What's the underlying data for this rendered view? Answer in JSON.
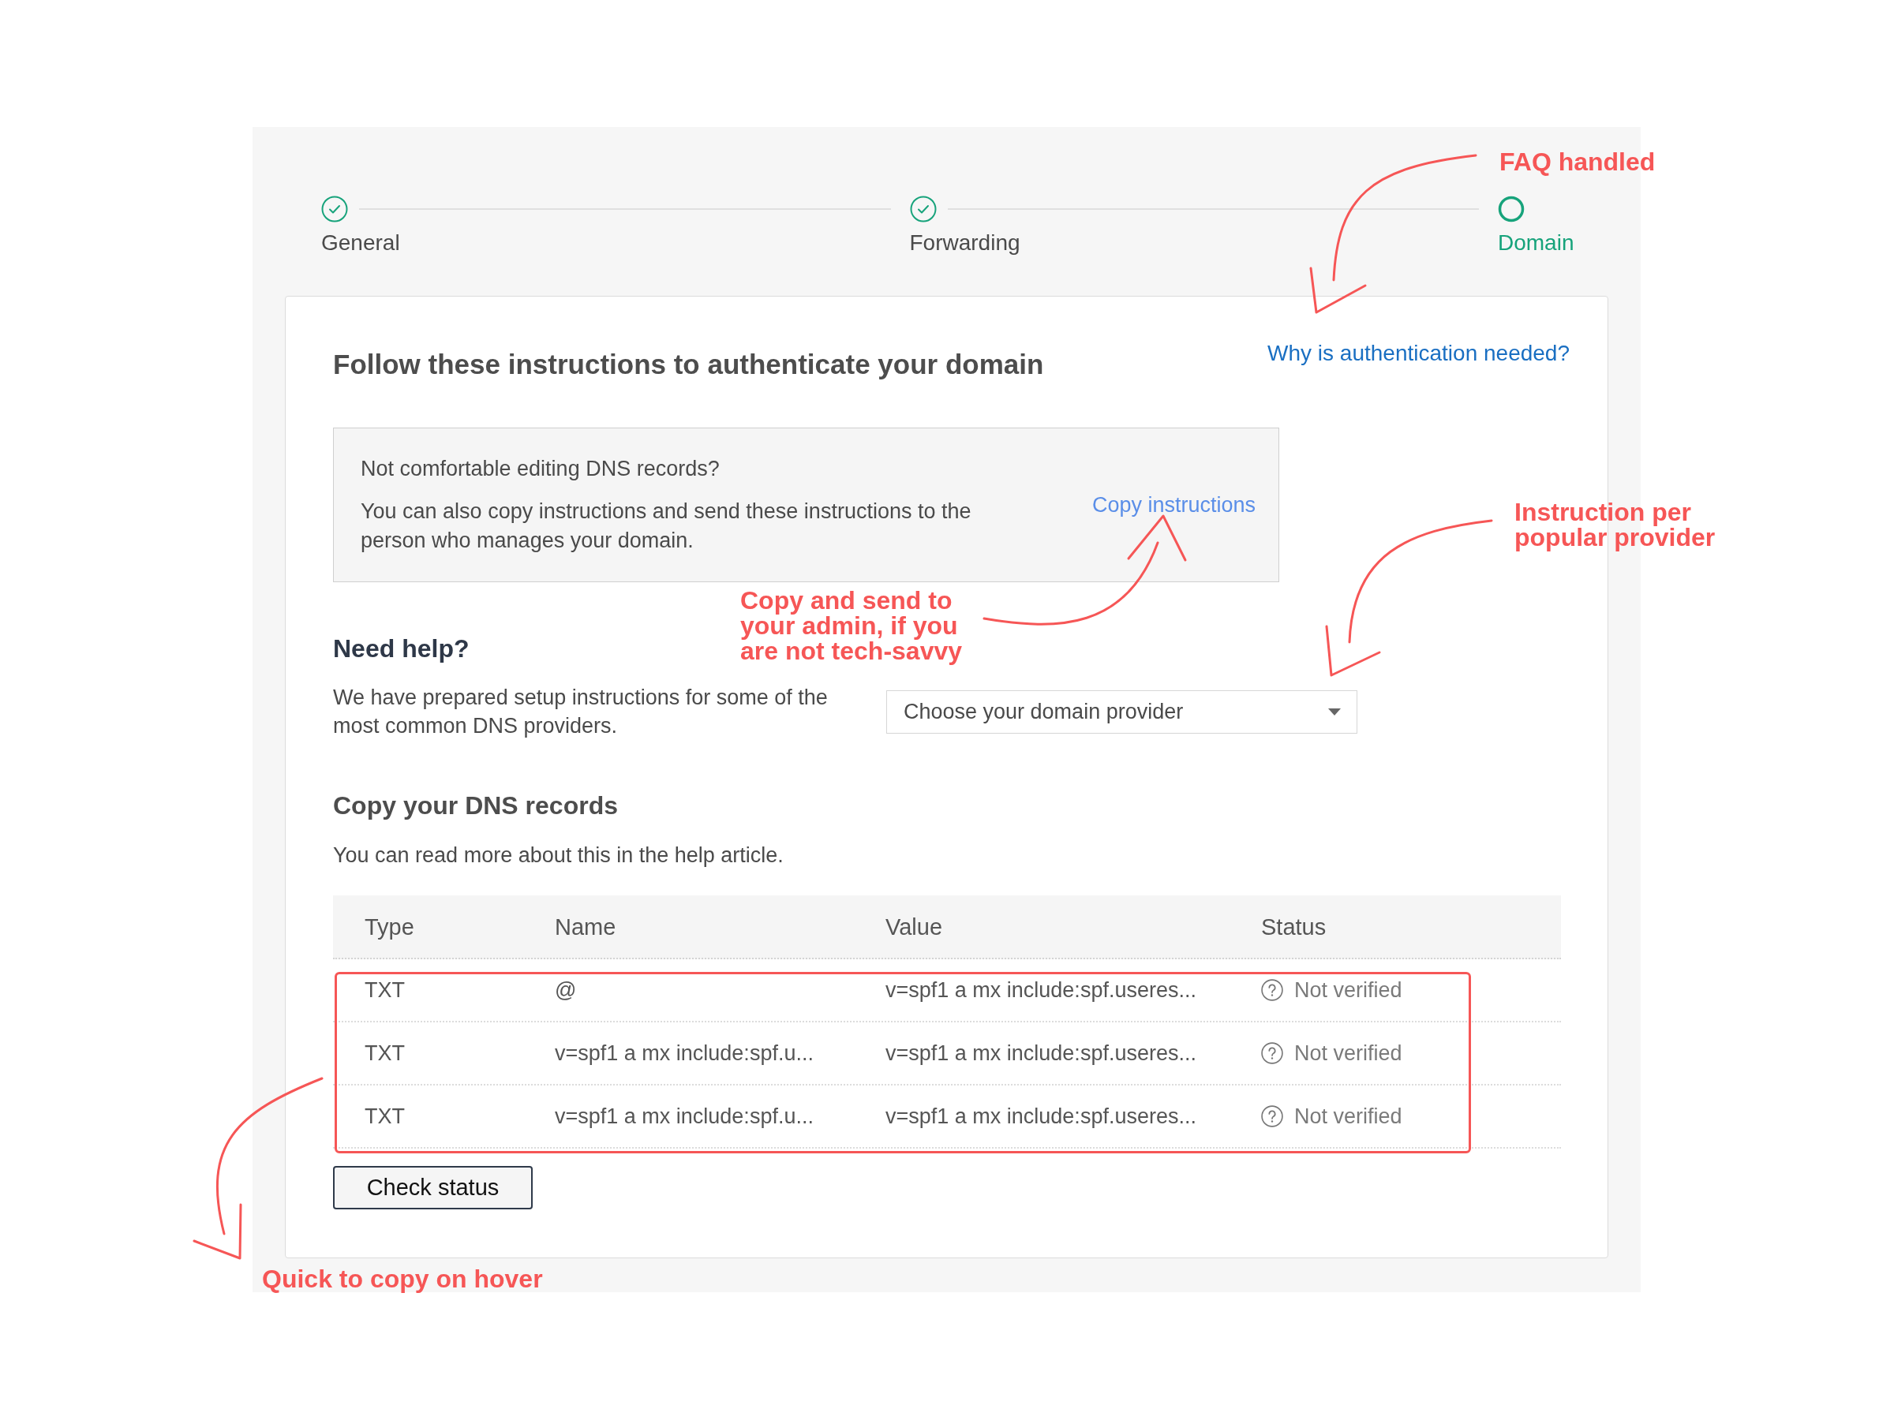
{
  "steps": [
    {
      "label": "General",
      "completed": true,
      "selected": false
    },
    {
      "label": "Forwarding",
      "completed": true,
      "selected": false
    },
    {
      "label": "Domain",
      "completed": false,
      "selected": true
    }
  ],
  "card": {
    "title": "Follow these instructions to authenticate your domain",
    "help_link": "Why is authentication needed?",
    "info_box": {
      "title": "Not comfortable editing DNS records?",
      "text": "You can also copy instructions and send these instructions to the person who manages your domain.",
      "link": "Copy instructions"
    },
    "help_section": {
      "title": "Need help?",
      "text": "We have prepared setup instructions for some of the most common DNS providers.",
      "dropdown": {
        "placeholder": "Choose your domain provider"
      }
    },
    "records_section": {
      "title": "Copy your DNS records",
      "text": "You can read more about this in the help article.",
      "table": {
        "columns": [
          "Type",
          "Name",
          "Value",
          "Status"
        ],
        "rows": [
          {
            "type": "TXT",
            "name": "@",
            "value": "v=spf1 a mx include:spf.useres...",
            "status": "Not verified"
          },
          {
            "type": "TXT",
            "name": "v=spf1 a mx include:spf.u...",
            "value": "v=spf1 a mx include:spf.useres...",
            "status": "Not verified"
          },
          {
            "type": "TXT",
            "name": "v=spf1 a mx include:spf.u...",
            "value": "v=spf1 a mx include:spf.useres...",
            "status": "Not verified"
          }
        ]
      },
      "button": "Check status"
    }
  },
  "annotations": [
    {
      "lines": [
        "FAQ handled"
      ]
    },
    {
      "lines": [
        "Instruction per",
        "popular provider"
      ]
    },
    {
      "lines": [
        "Copy and send to",
        "your admin, if you",
        "are not tech-savvy"
      ]
    },
    {
      "lines": [
        "Quick to copy on hover"
      ]
    }
  ]
}
